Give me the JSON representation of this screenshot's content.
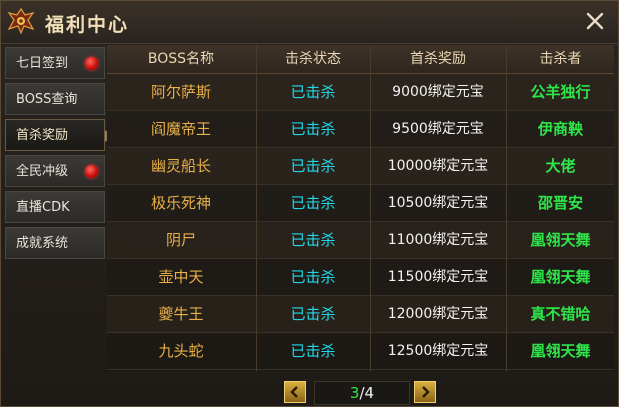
{
  "window": {
    "title": "福利中心"
  },
  "sidebar": {
    "items": [
      {
        "label": "七日签到",
        "badge": true
      },
      {
        "label": "BOSS查询",
        "badge": false
      },
      {
        "label": "首杀奖励",
        "badge": false,
        "active": true
      },
      {
        "label": "全民冲级",
        "badge": true
      },
      {
        "label": "直播CDK",
        "badge": false
      },
      {
        "label": "成就系统",
        "badge": false
      }
    ]
  },
  "table": {
    "headers": {
      "boss": "BOSS名称",
      "status": "击杀状态",
      "reward": "首杀奖励",
      "killer": "击杀者"
    },
    "rows": [
      {
        "boss": "阿尔萨斯",
        "status": "已击杀",
        "reward": "9000绑定元宝",
        "killer": "公羊独行"
      },
      {
        "boss": "阎魔帝王",
        "status": "已击杀",
        "reward": "9500绑定元宝",
        "killer": "伊商鞅"
      },
      {
        "boss": "幽灵船长",
        "status": "已击杀",
        "reward": "10000绑定元宝",
        "killer": "大佬"
      },
      {
        "boss": "极乐死神",
        "status": "已击杀",
        "reward": "10500绑定元宝",
        "killer": "邵晋安"
      },
      {
        "boss": "阴尸",
        "status": "已击杀",
        "reward": "11000绑定元宝",
        "killer": "凰翎天舞"
      },
      {
        "boss": "壶中天",
        "status": "已击杀",
        "reward": "11500绑定元宝",
        "killer": "凰翎天舞"
      },
      {
        "boss": "夔牛王",
        "status": "已击杀",
        "reward": "12000绑定元宝",
        "killer": "真不错哈"
      },
      {
        "boss": "九头蛇",
        "status": "已击杀",
        "reward": "12500绑定元宝",
        "killer": "凰翎天舞"
      }
    ]
  },
  "pagination": {
    "current": "3",
    "separator": "/",
    "total": "4"
  },
  "icons": {
    "logo": "dragon-emblem-icon",
    "close": "close-icon",
    "prev": "chevron-left-icon",
    "next": "chevron-right-icon",
    "badge": "red-dot-notification-icon"
  },
  "colors": {
    "boss_name": "#e8b048",
    "status": "#22d8e8",
    "killer": "#2ee64a",
    "header_text": "#e8d7b2",
    "badge": "#d01010"
  }
}
